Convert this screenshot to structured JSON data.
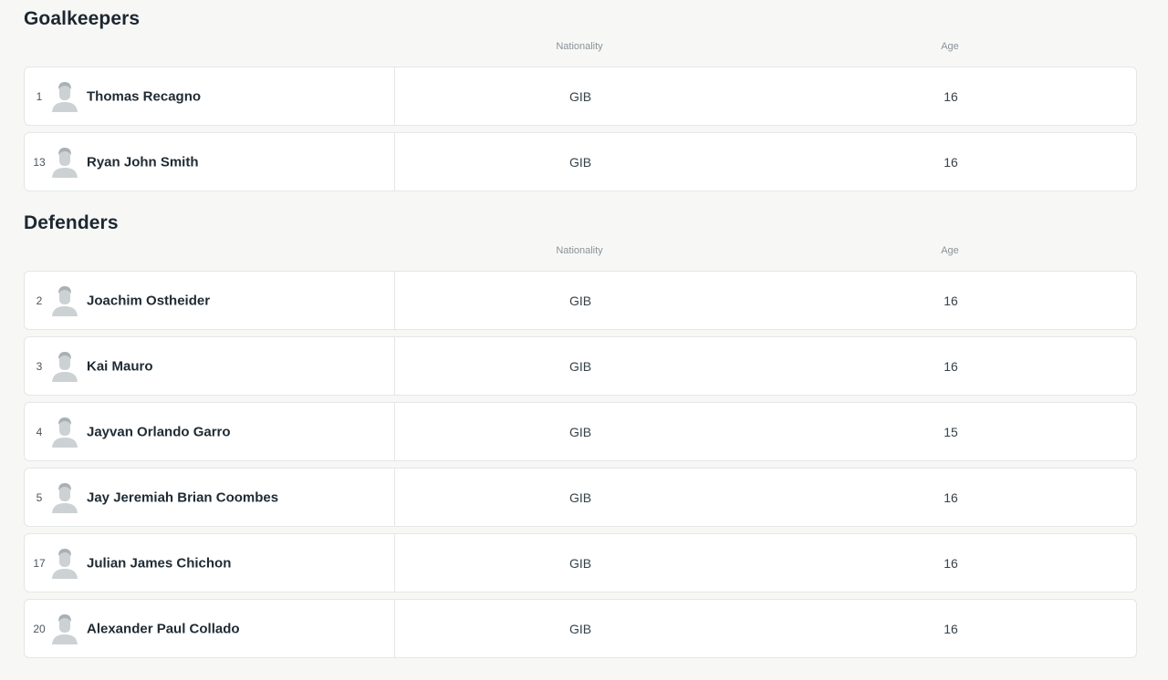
{
  "sections": [
    {
      "title": "Goalkeepers",
      "headers": {
        "nationality": "Nationality",
        "age": "Age"
      },
      "players": [
        {
          "number": "1",
          "name": "Thomas Recagno",
          "nationality": "GIB",
          "age": "16"
        },
        {
          "number": "13",
          "name": "Ryan John Smith",
          "nationality": "GIB",
          "age": "16"
        }
      ]
    },
    {
      "title": "Defenders",
      "headers": {
        "nationality": "Nationality",
        "age": "Age"
      },
      "players": [
        {
          "number": "2",
          "name": "Joachim Ostheider",
          "nationality": "GIB",
          "age": "16"
        },
        {
          "number": "3",
          "name": "Kai Mauro",
          "nationality": "GIB",
          "age": "16"
        },
        {
          "number": "4",
          "name": "Jayvan Orlando Garro",
          "nationality": "GIB",
          "age": "15"
        },
        {
          "number": "5",
          "name": "Jay Jeremiah Brian Coombes",
          "nationality": "GIB",
          "age": "16"
        },
        {
          "number": "17",
          "name": "Julian James Chichon",
          "nationality": "GIB",
          "age": "16"
        },
        {
          "number": "20",
          "name": "Alexander Paul Collado",
          "nationality": "GIB",
          "age": "16"
        }
      ]
    }
  ],
  "icons": {
    "player_avatar": "person-silhouette-icon"
  }
}
